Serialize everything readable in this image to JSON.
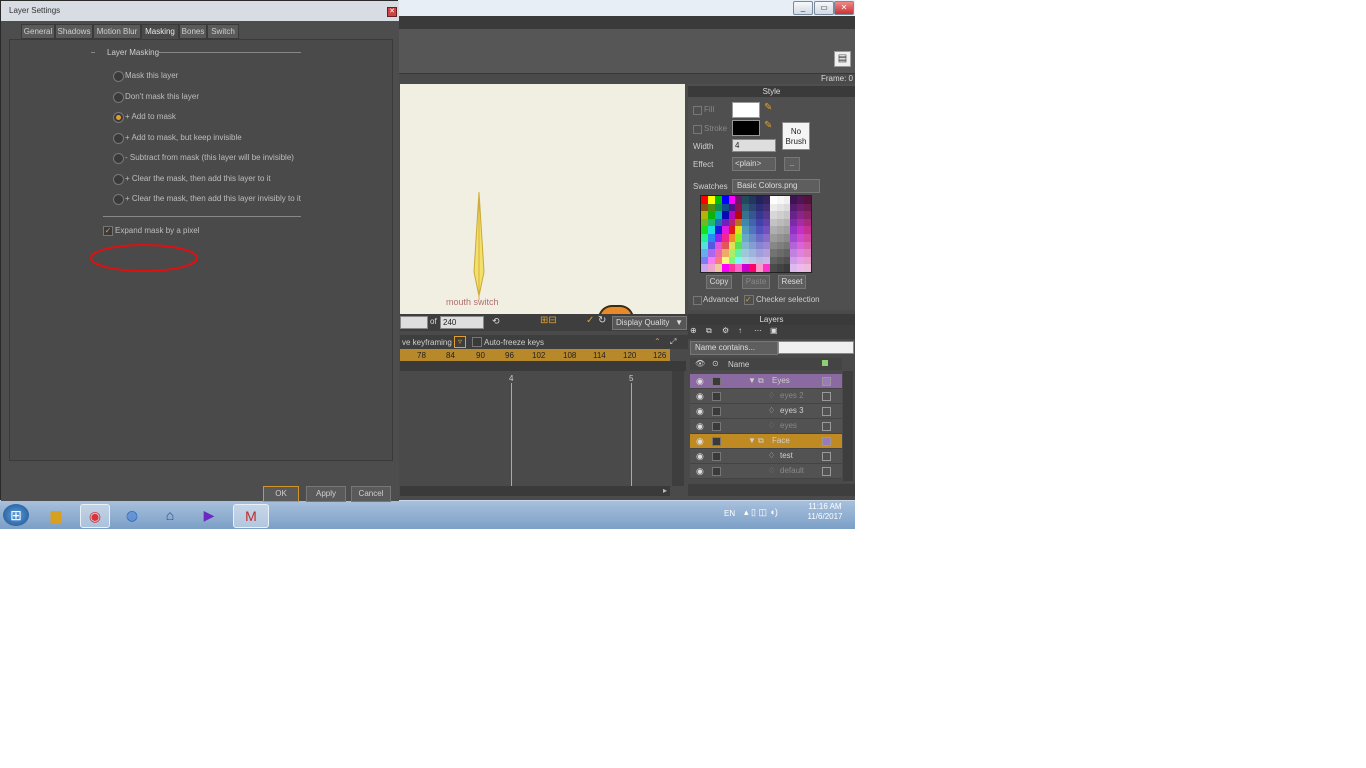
{
  "dialog": {
    "title": "Layer Settings",
    "tabs": [
      "General",
      "Shadows",
      "Motion Blur",
      "Masking",
      "Bones",
      "Switch"
    ],
    "active_tab": "Masking",
    "section_title": "Layer Masking",
    "options": [
      "Mask this layer",
      "Don't mask this layer",
      "+ Add to mask",
      "+ Add to mask, but keep invisible",
      "- Subtract from mask (this layer will be invisible)",
      "+ Clear the mask, then add this layer to it",
      "+ Clear the mask, then add this layer invisibly to it"
    ],
    "selected_option": 2,
    "expand_label": "Expand mask by a pixel",
    "expand_checked": true,
    "buttons": {
      "ok": "OK",
      "apply": "Apply",
      "cancel": "Cancel"
    },
    "annotation_color": "#e01010"
  },
  "app": {
    "frame_label": "Frame: 0",
    "canvas_label": "mouth switch",
    "canvas_bar": {
      "of_label": "of",
      "end_frame": "240",
      "display_quality": "Display Quality"
    },
    "timeline": {
      "keyframing_label": "ve keyframing",
      "auto_freeze": "Auto-freeze keys",
      "ruler": [
        "78",
        "84",
        "90",
        "96",
        "102",
        "108",
        "114",
        "120",
        "126"
      ],
      "markers": [
        "4",
        "5"
      ]
    },
    "style": {
      "title": "Style",
      "fill_label": "Fill",
      "stroke_label": "Stroke",
      "width_label": "Width",
      "width_value": "4",
      "effect_label": "Effect",
      "effect_value": "<plain>",
      "no_brush": "No Brush",
      "swatches_label": "Swatches",
      "swatches_value": "Basic Colors.png",
      "copy": "Copy",
      "paste": "Paste",
      "reset": "Reset",
      "advanced": "Advanced",
      "checker": "Checker selection",
      "fill_color": "#ffffff",
      "stroke_color": "#000000"
    },
    "layers": {
      "title": "Layers",
      "filter": "Name contains...",
      "col_name": "Name",
      "rows": [
        {
          "name": "Eyes",
          "group": true,
          "highlight": "purple"
        },
        {
          "name": "eyes 2",
          "group": false,
          "highlight": "none"
        },
        {
          "name": "eyes 3",
          "group": false,
          "highlight": "none"
        },
        {
          "name": "eyes",
          "group": false,
          "highlight": "none"
        },
        {
          "name": "Face",
          "group": true,
          "highlight": "orange"
        },
        {
          "name": "test",
          "group": false,
          "highlight": "none"
        },
        {
          "name": "default",
          "group": false,
          "highlight": "none"
        }
      ]
    }
  },
  "taskbar": {
    "lang": "EN",
    "time": "11:16 AM",
    "date": "11/6/2017",
    "icons": [
      "start-orb",
      "explorer",
      "chrome",
      "globe",
      "network",
      "media",
      "moho"
    ]
  }
}
